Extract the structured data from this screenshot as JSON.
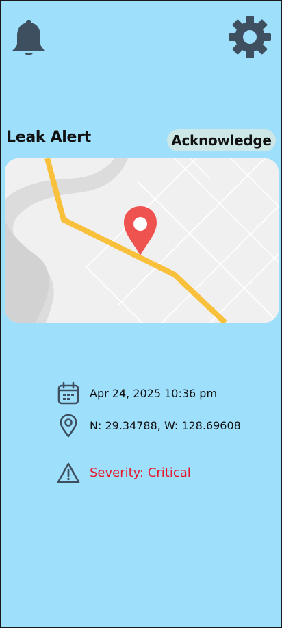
{
  "header": {
    "bell_icon": "bell-icon",
    "settings_icon": "gear-icon"
  },
  "alert": {
    "title": "Leak Alert",
    "acknowledge_label": "Acknowledge"
  },
  "map": {
    "marker_icon": "map-pin-icon",
    "route_color": "#f8c03b",
    "marker_color": "#ef5350"
  },
  "details": {
    "datetime": "Apr 24, 2025 10:36 pm",
    "coordinates": "N: 29.34788, W: 128.69608",
    "severity": "Severity: Critical",
    "severity_color": "#e8182a",
    "icons": {
      "datetime": "calendar-icon",
      "coordinates": "location-pin-icon",
      "severity": "warning-icon"
    }
  },
  "colors": {
    "background": "#9edffc",
    "icon": "#3e5060"
  }
}
